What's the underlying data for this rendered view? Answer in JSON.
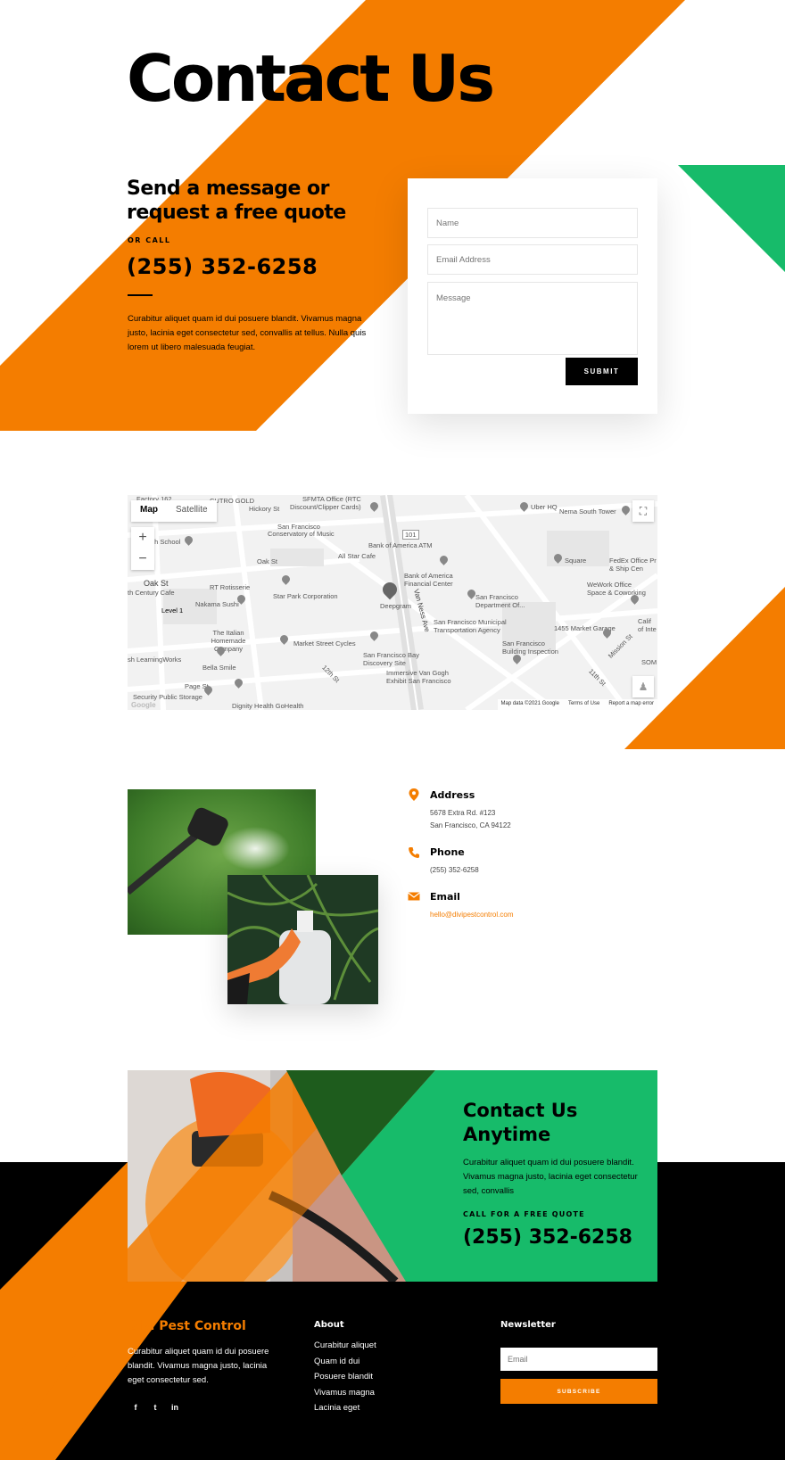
{
  "colors": {
    "orange": "#f47d00",
    "green": "#17bb6a",
    "black": "#000000",
    "white": "#ffffff"
  },
  "hero": {
    "title": "Contact Us",
    "heading": "Send a message or request a free quote",
    "or_call": "OR CALL",
    "phone": "(255) 352-6258",
    "text": "Curabitur aliquet quam id dui posuere blandit. Vivamus magna justo, lacinia eget consectetur sed, convallis at tellus. Nulla quis lorem ut libero malesuada feugiat."
  },
  "form": {
    "name_placeholder": "Name",
    "email_placeholder": "Email Address",
    "message_placeholder": "Message",
    "submit_label": "SUBMIT"
  },
  "map": {
    "map_tab": "Map",
    "satellite_tab": "Satellite",
    "zoom_in": "+",
    "zoom_out": "−",
    "attribution": {
      "data": "Map data ©2021 Google",
      "terms": "Terms of Use",
      "report": "Report a map error"
    },
    "google": "Google",
    "labels": {
      "l1": "Factory 162",
      "l2": "CUTRO GOLD",
      "l3": "SFMTA Office (RTC",
      "l4": "Discount/Clipper Cards)",
      "l5": "Hickory St",
      "l6": "San Francisco",
      "l7": "Conservatory of Music",
      "l8": "Uber HQ",
      "l9": "Nema South Tower",
      "l10": "Oak St",
      "l11": "Bank of America ATM",
      "l12": "All Star Cafe",
      "l13": "RT Rotisserie",
      "l14": "Star Park Corporation",
      "l15": "Bank of America Financial Center",
      "l16": "Deepgram",
      "l17": "San Francisco Department Of...",
      "l18": "Square",
      "l19": "FedEx Office Pr & Ship Cen",
      "l20": "WeWork Office Space & Coworking",
      "l21": "Nakama Sushi",
      "l22": "Level 1",
      "l23": "San Francisco Municipal Transportation Agency",
      "l24": "1455 Market Garage",
      "l25": "The Italian Homemade Company",
      "l26": "Market Street Cycles",
      "l27": "San Francisco Building Inspection",
      "l28": "Bella Smile",
      "l29": "San Francisco Bay Discovery Site",
      "l30": "Immersive Van Gogh Exhibit San Francisco",
      "l31": "Page St",
      "l32": "Security Public Storage",
      "l33": "Dignity Health GoHealth",
      "l34": "Van Ness Ave",
      "l35": "Mission St",
      "l36": "11th St",
      "l37": "12th St",
      "l38": "Oak St",
      "l39": "101",
      "l40": "gh School",
      "l41": "th Century Cafe",
      "l42": "sh LearningWorks",
      "l43": "Calif of Inte",
      "l44": "SOM"
    }
  },
  "contact_info": {
    "address_title": "Address",
    "address_line1": "5678 Extra Rd. #123",
    "address_line2": "San Francisco, CA 94122",
    "phone_title": "Phone",
    "phone": "(255) 352-6258",
    "email_title": "Email",
    "email": "hello@divipestcontrol.com"
  },
  "cta": {
    "title": "Contact Us Anytime",
    "text": "Curabitur aliquet quam id dui posuere blandit. Vivamus magna justo, lacinia eget consectetur sed, convallis",
    "call": "CALL FOR A FREE QUOTE",
    "phone": "(255) 352-6258"
  },
  "footer": {
    "brand": "Divi Pest Control",
    "text": "Curabitur aliquet quam id dui posuere blandit. Vivamus magna justo, lacinia eget consectetur sed.",
    "social": {
      "facebook": "f",
      "twitter": "t",
      "linkedin": "in"
    },
    "about_title": "About",
    "about_links": [
      "Curabitur aliquet",
      "Quam id dui",
      "Posuere blandit",
      "Vivamus magna",
      "Lacinia eget"
    ],
    "newsletter_title": "Newsletter",
    "newsletter_placeholder": "Email",
    "subscribe_label": "SUBSCRIBE"
  }
}
